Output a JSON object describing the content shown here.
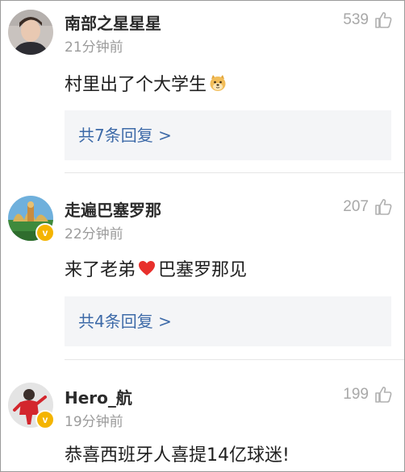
{
  "comments": [
    {
      "username": "南部之星星星",
      "time": "21分钟前",
      "likes": "539",
      "text_before": "村里出了个大学生",
      "text_after": "",
      "emoji": "doge-emoji",
      "verified": false,
      "reply_summary": "共7条回复 >"
    },
    {
      "username": "走遍巴塞罗那",
      "time": "22分钟前",
      "likes": "207",
      "text_before": "来了老弟",
      "text_after": "巴塞罗那见",
      "emoji": "red-heart-emoji",
      "verified": true,
      "verified_mark": "v",
      "reply_summary": "共4条回复 >"
    },
    {
      "username": "Hero_航",
      "time": "19分钟前",
      "likes": "199",
      "text_before": "恭喜西班牙人喜提14亿球迷!",
      "text_after": "",
      "verified": true,
      "verified_mark": "v"
    }
  ],
  "colors": {
    "username": "#2b2b2b",
    "time": "#9b9b9b",
    "reply_link": "#3d6aa8",
    "reply_bg": "#f4f5f7",
    "badge": "#f4b400"
  },
  "icons": {
    "like": "thumbs-up-outline-icon"
  }
}
